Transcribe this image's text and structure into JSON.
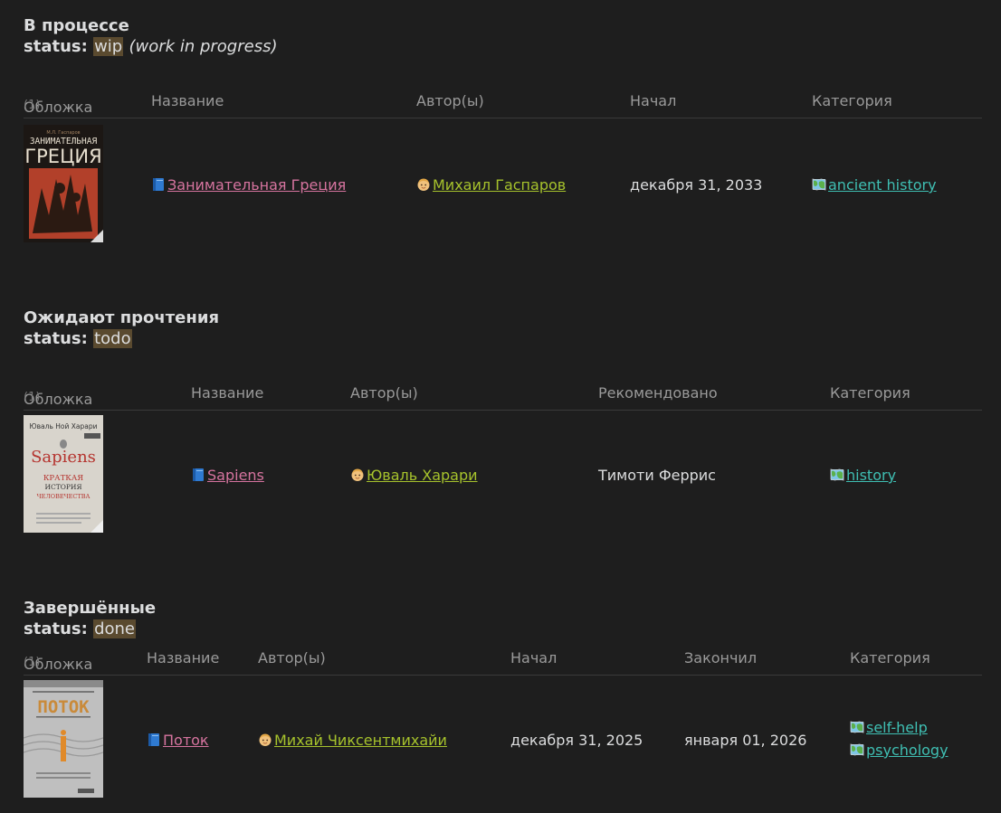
{
  "sections": [
    {
      "heading": "В процессе",
      "status_label": "status:",
      "status_value": "wip",
      "status_note": "(work in progress)",
      "columns": {
        "cover": "Обложка",
        "cover_count": "(1)",
        "title": "Название",
        "authors": "Автор(ы)",
        "started": "Начал",
        "category": "Категория"
      },
      "rows": [
        {
          "cover_author": "М.Л. Гаспаров",
          "cover_title_1": "ЗАНИМАТЕЛЬНАЯ",
          "cover_title_2": "ГРЕЦИЯ",
          "title": "Занимательная Греция",
          "author": "Михаил Гаспаров",
          "started": "декабря 31, 2033",
          "categories": [
            "ancient history"
          ]
        }
      ]
    },
    {
      "heading": "Ожидают прочтения",
      "status_label": "status:",
      "status_value": "todo",
      "columns": {
        "cover": "Обложка",
        "cover_count": "(1)",
        "title": "Название",
        "authors": "Автор(ы)",
        "recommended": "Рекомендовано",
        "category": "Категория"
      },
      "rows": [
        {
          "cover_author": "Юваль Ной Харари",
          "cover_title_1": "Sapiens",
          "cover_title_2": "КРАТКАЯ",
          "cover_title_3": "ИСТОРИЯ",
          "cover_title_4": "ЧЕЛОВЕЧЕСТВА",
          "title": "Sapiens",
          "author": "Юваль Харари",
          "recommended": "Тимоти Феррис",
          "categories": [
            "history"
          ]
        }
      ]
    },
    {
      "heading": "Завершённые",
      "status_label": "status:",
      "status_value": "done",
      "columns": {
        "cover": "Обложка",
        "cover_count": "(1)",
        "title": "Название",
        "authors": "Автор(ы)",
        "started": "Начал",
        "finished": "Закончил",
        "category": "Категория"
      },
      "rows": [
        {
          "cover_title_1": "ПОТОК",
          "title": "Поток",
          "author": "Михай Чиксентмихайи",
          "started": "декабря 31, 2025",
          "finished": "января 01, 2026",
          "categories": [
            "self-help",
            "psychology"
          ]
        }
      ]
    }
  ],
  "icons": {
    "book": "blue-book-icon",
    "author": "person-icon",
    "category": "world-map-icon"
  }
}
